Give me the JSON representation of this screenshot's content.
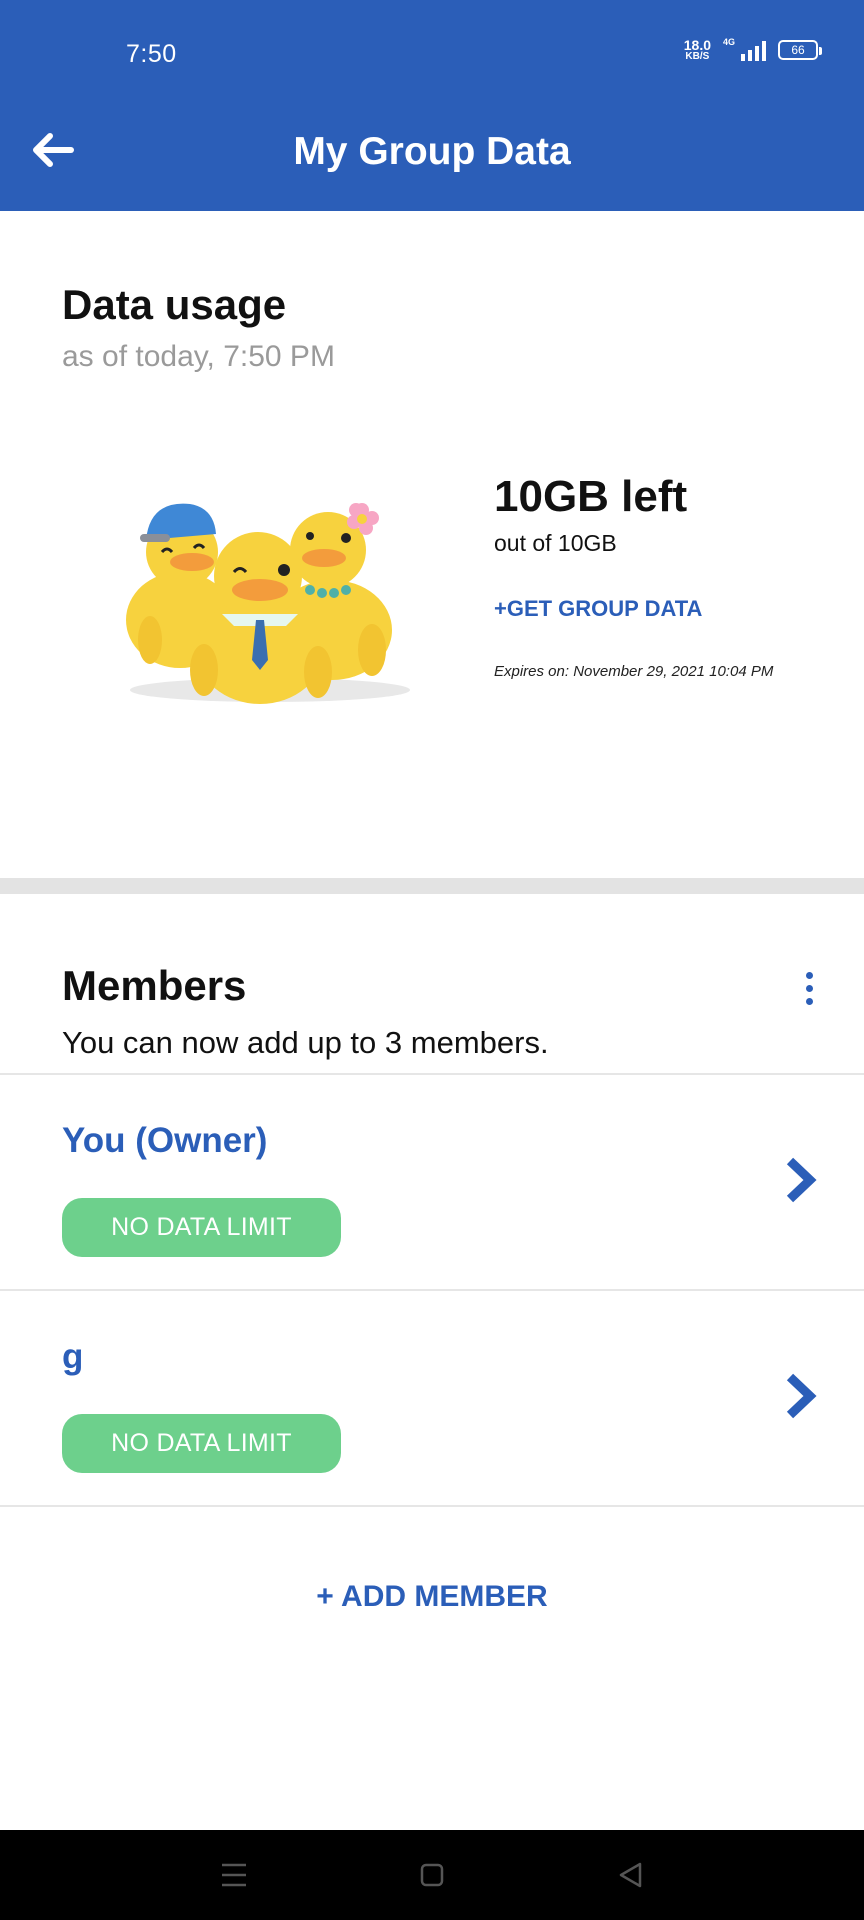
{
  "status_bar": {
    "time": "7:50",
    "net_speed": "18.0",
    "net_unit": "KB/S",
    "network": "4G",
    "battery": "66"
  },
  "toolbar": {
    "back_icon": "arrow-left-icon",
    "title": "My Group Data"
  },
  "usage": {
    "heading": "Data usage",
    "as_of": "as of today, 7:50 PM",
    "illustration": "ducks-illustration",
    "left": "10GB left",
    "out_of": "out of 10GB",
    "get_data": "+GET GROUP DATA",
    "expires": "Expires on: November 29, 2021 10:04 PM"
  },
  "members": {
    "heading": "Members",
    "subtitle": "You can now add up to 3 members.",
    "more_icon": "more-vertical-icon",
    "items": [
      {
        "name": "You (Owner)",
        "limit": "NO DATA LIMIT"
      },
      {
        "name": "g",
        "limit": "NO DATA LIMIT"
      }
    ],
    "add_label": "+ ADD MEMBER"
  },
  "nav_bar": {
    "menu_icon": "menu-icon",
    "home_icon": "home-icon",
    "back_icon": "triangle-back-icon"
  },
  "colors": {
    "primary": "#2b5eb8",
    "pill": "#6dd08c",
    "divider": "#e3e3e3"
  }
}
